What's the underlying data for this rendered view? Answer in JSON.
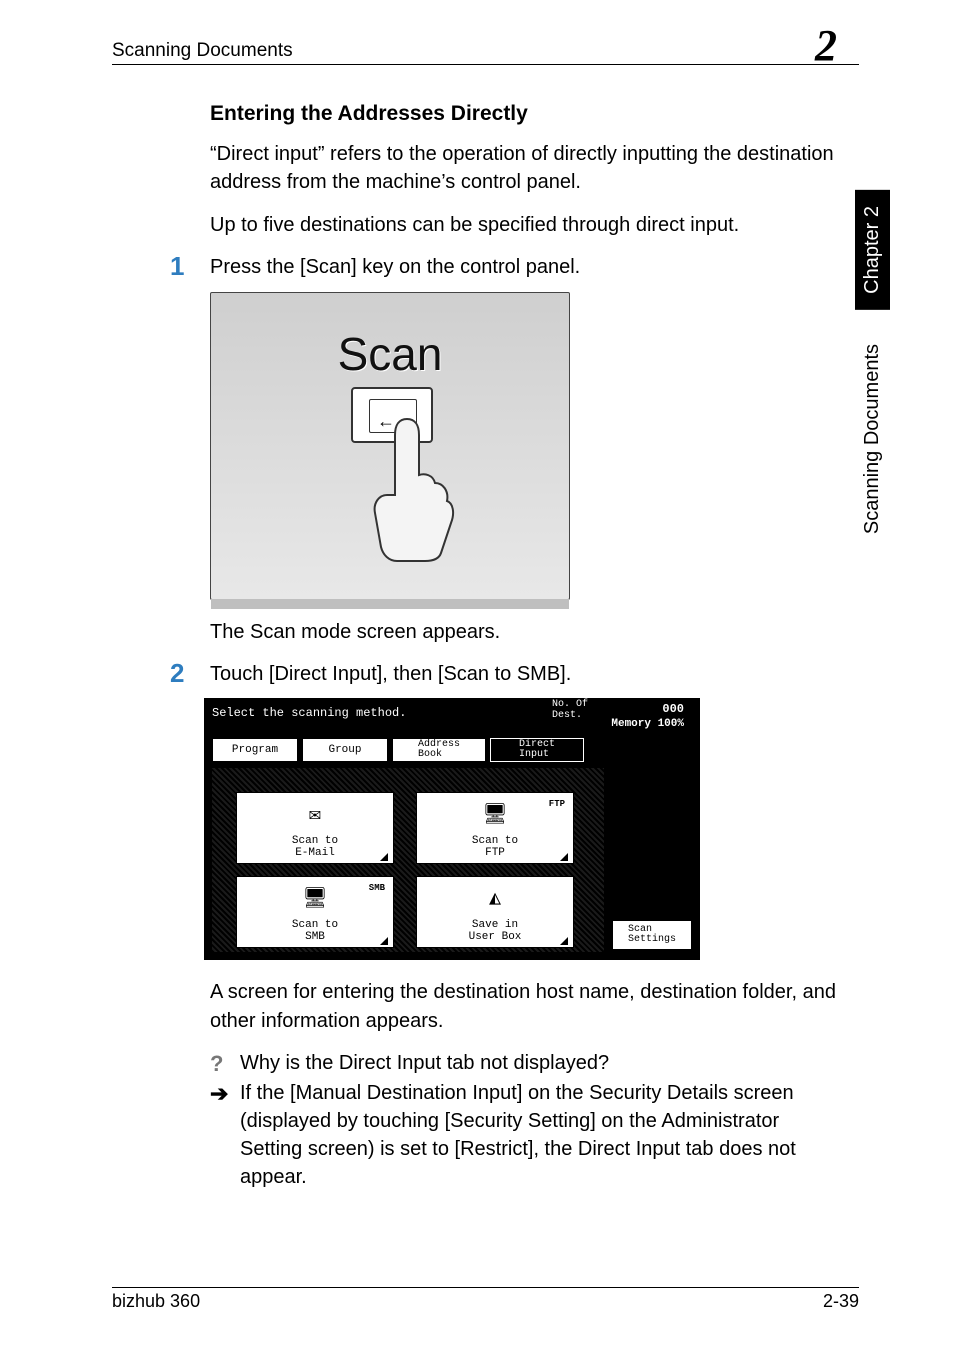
{
  "header": {
    "section": "Scanning Documents",
    "chapter_num": "2"
  },
  "side": {
    "chapter_tab": "Chapter 2",
    "section_tab": "Scanning Documents"
  },
  "h4": "Entering the Addresses Directly",
  "p1": "“Direct input” refers to the operation of directly inputting the destination address from the machine’s control panel.",
  "p2": "Up to five destinations can be specified through direct input.",
  "step1": {
    "num": "1",
    "text": "Press the [Scan] key on the control panel."
  },
  "fig1": {
    "label": "Scan"
  },
  "after_scan": "The Scan mode screen appears.",
  "step2": {
    "num": "2",
    "text": "Touch [Direct Input], then [Scan to SMB]."
  },
  "scan_screen": {
    "title": "Select the scanning method.",
    "no_of_label": "No. Of\nDest.",
    "no_of_value": "000",
    "memory": "Memory 100%",
    "tabs": {
      "program": "Program",
      "group": "Group",
      "addrbook": "Address\nBook",
      "direct": "Direct\nInput"
    },
    "buttons": {
      "email": "Scan to\nE-Mail",
      "ftp": "Scan to\nFTP",
      "ftp_icon_label": "FTP",
      "smb": "Scan to\nSMB",
      "smb_icon_label": "SMB",
      "box": "Save in\nUser Box"
    },
    "scan_settings": "Scan\nSettings"
  },
  "p3": "A screen for entering the destination host name, destination folder, and other information appears.",
  "qa": {
    "q": "Why is the Direct Input tab not displayed?",
    "a": "If the [Manual Destination Input] on the Security Details screen (displayed by touching [Security Setting] on the Administrator Setting screen) is set to [Restrict], the Direct Input tab does not appear."
  },
  "footer": {
    "left": "bizhub 360",
    "right": "2-39"
  }
}
